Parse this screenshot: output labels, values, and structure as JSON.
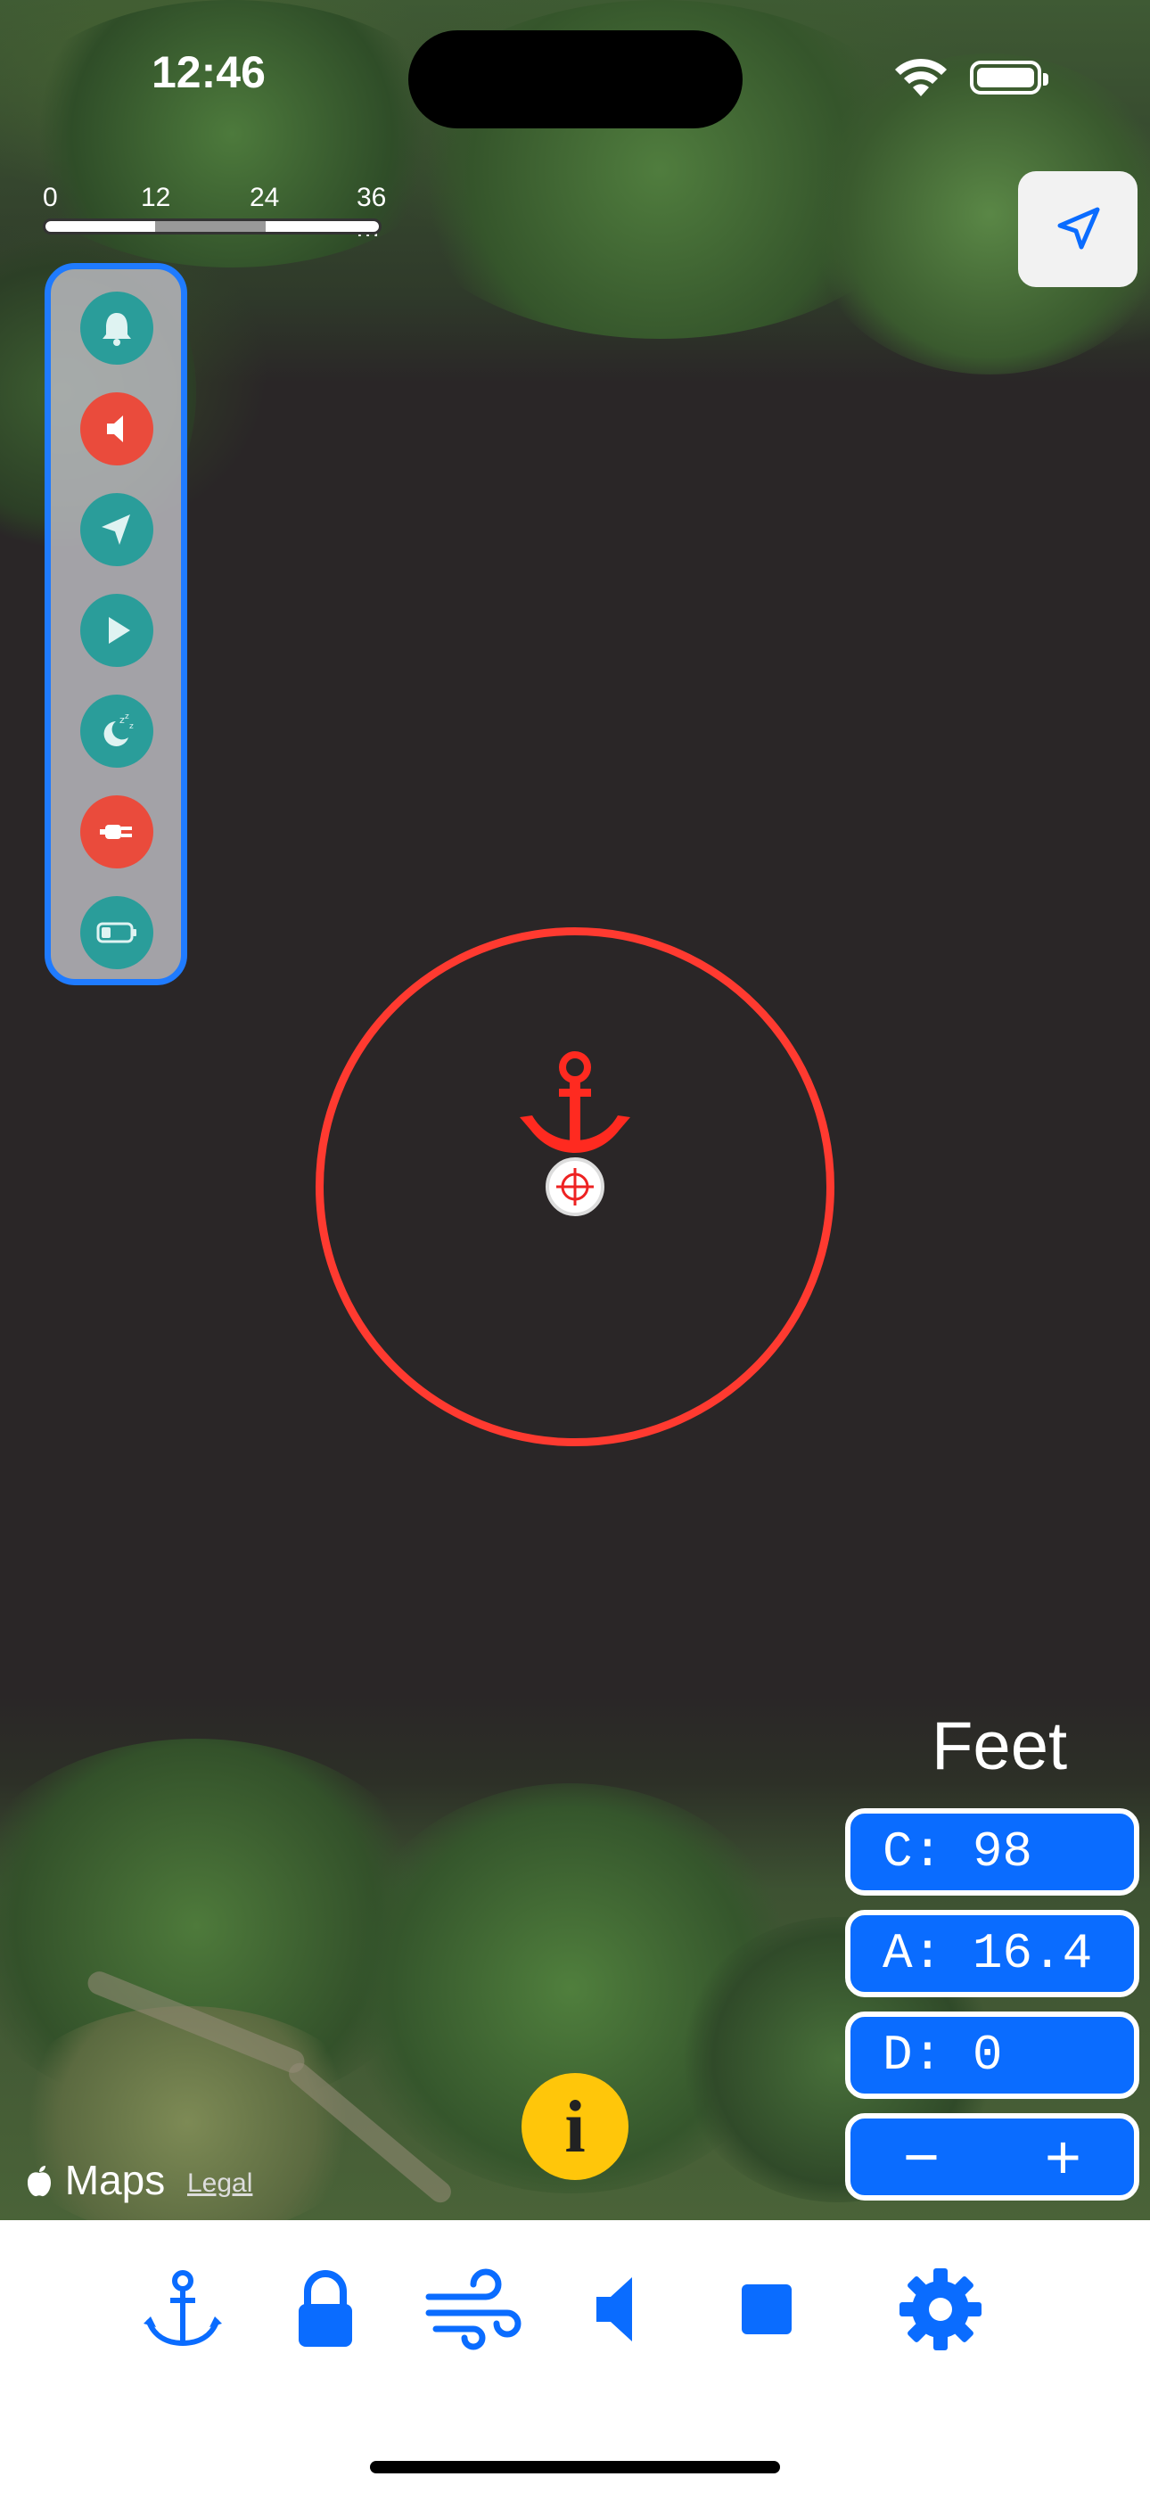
{
  "status_bar": {
    "time": "12:46"
  },
  "scale_bar": {
    "labels": [
      "0",
      "12",
      "24",
      "36 m"
    ]
  },
  "side_panel": {
    "buttons": [
      {
        "icon": "bell-icon",
        "color": "#2a9d9a"
      },
      {
        "icon": "speaker-icon",
        "color": "#ea4b3c"
      },
      {
        "icon": "navigation-arrow-icon",
        "color": "#2a9d9a"
      },
      {
        "icon": "play-icon",
        "color": "#2a9d9a"
      },
      {
        "icon": "sleep-moon-icon",
        "color": "#2a9d9a"
      },
      {
        "icon": "power-plug-icon",
        "color": "#ea4b3c"
      },
      {
        "icon": "battery-low-icon",
        "color": "#2a9d9a"
      }
    ]
  },
  "readouts": {
    "unit": "Feet",
    "c": "C: 98",
    "a": "A: 16.4",
    "d": "D: 0",
    "minus": "−",
    "plus": "+"
  },
  "info_button": {
    "label": "i"
  },
  "attribution": {
    "maps": "Maps",
    "legal": "Legal"
  },
  "tabbar": {
    "tabs": [
      "anchor-icon",
      "lock-icon",
      "wind-icon",
      "speaker-icon",
      "stop-icon",
      "gear-icon"
    ],
    "accent": "#0a6cff"
  },
  "colors": {
    "zone": "#ff3a30",
    "accent": "#0a6cff",
    "info": "#ffc60a"
  }
}
